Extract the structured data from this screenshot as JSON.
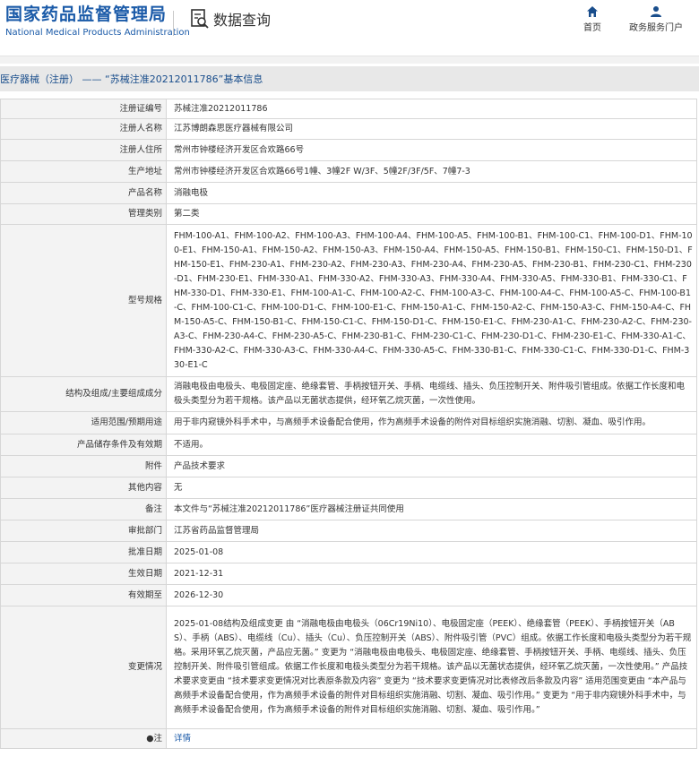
{
  "header": {
    "logo_cn": "国家药品监督管理局",
    "logo_en": "National Medical Products Administration",
    "section_title": "数据查询",
    "nav_home": "首页",
    "nav_service": "政务服务门户"
  },
  "breadcrumb": "医疗器械（注册） —— “苏械注准20212011786”基本信息",
  "rows": [
    {
      "label": "注册证编号",
      "value": "苏械注准20212011786"
    },
    {
      "label": "注册人名称",
      "value": "江苏博朗森思医疗器械有限公司"
    },
    {
      "label": "注册人住所",
      "value": "常州市钟楼经济开发区合欢路66号"
    },
    {
      "label": "生产地址",
      "value": "常州市钟楼经济开发区合欢路66号1幢、3幢2F W/3F、5幢2F/3F/5F、7幢7-3"
    },
    {
      "label": "产品名称",
      "value": "消融电极"
    },
    {
      "label": "管理类别",
      "value": "第二类"
    },
    {
      "label": "型号规格",
      "value": "FHM-100-A1、FHM-100-A2、FHM-100-A3、FHM-100-A4、FHM-100-A5、FHM-100-B1、FHM-100-C1、FHM-100-D1、FHM-100-E1、FHM-150-A1、FHM-150-A2、FHM-150-A3、FHM-150-A4、FHM-150-A5、FHM-150-B1、FHM-150-C1、FHM-150-D1、FHM-150-E1、FHM-230-A1、FHM-230-A2、FHM-230-A3、FHM-230-A4、FHM-230-A5、FHM-230-B1、FHM-230-C1、FHM-230-D1、FHM-230-E1、FHM-330-A1、FHM-330-A2、FHM-330-A3、FHM-330-A4、FHM-330-A5、FHM-330-B1、FHM-330-C1、FHM-330-D1、FHM-330-E1、FHM-100-A1-C、FHM-100-A2-C、FHM-100-A3-C、FHM-100-A4-C、FHM-100-A5-C、FHM-100-B1-C、FHM-100-C1-C、FHM-100-D1-C、FHM-100-E1-C、FHM-150-A1-C、FHM-150-A2-C、FHM-150-A3-C、FHM-150-A4-C、FHM-150-A5-C、FHM-150-B1-C、FHM-150-C1-C、FHM-150-D1-C、FHM-150-E1-C、FHM-230-A1-C、FHM-230-A2-C、FHM-230-A3-C、FHM-230-A4-C、FHM-230-A5-C、FHM-230-B1-C、FHM-230-C1-C、FHM-230-D1-C、FHM-230-E1-C、FHM-330-A1-C、FHM-330-A2-C、FHM-330-A3-C、FHM-330-A4-C、FHM-330-A5-C、FHM-330-B1-C、FHM-330-C1-C、FHM-330-D1-C、FHM-330-E1-C"
    },
    {
      "label": "结构及组成/主要组成成分",
      "value": "消融电极由电极头、电极固定座、绝缘套管、手柄按钮开关、手柄、电缆线、插头、负压控制开关、附件吸引管组成。依据工作长度和电极头类型分为若干规格。该产品以无菌状态提供，经环氧乙烷灭菌，一次性使用。"
    },
    {
      "label": "适用范围/预期用途",
      "value": "用于非内窥镜外科手术中，与高频手术设备配合使用，作为高频手术设备的附件对目标组织实施消融、切割、凝血、吸引作用。"
    },
    {
      "label": "产品储存条件及有效期",
      "value": "不适用。"
    },
    {
      "label": "附件",
      "value": "产品技术要求"
    },
    {
      "label": "其他内容",
      "value": "无"
    },
    {
      "label": "备注",
      "value": "本文件与“苏械注准20212011786”医疗器械注册证共同使用"
    },
    {
      "label": "审批部门",
      "value": "江苏省药品监督管理局"
    },
    {
      "label": "批准日期",
      "value": "2025-01-08"
    },
    {
      "label": "生效日期",
      "value": "2021-12-31"
    },
    {
      "label": "有效期至",
      "value": "2026-12-30"
    },
    {
      "label": "变更情况",
      "value": "2025-01-08结构及组成变更 由 “消融电极由电极头（06Cr19Ni10）、电极固定座（PEEK）、绝缘套管（PEEK）、手柄按钮开关（ABS）、手柄（ABS）、电缆线（Cu）、插头（Cu）、负压控制开关（ABS）、附件吸引管（PVC）组成。依据工作长度和电极头类型分为若干规格。采用环氧乙烷灭菌，产品应无菌。” 变更为 “消融电极由电极头、电极固定座、绝缘套管、手柄按钮开关、手柄、电缆线、插头、负压控制开关、附件吸引管组成。依据工作长度和电极头类型分为若干规格。该产品以无菌状态提供，经环氧乙烷灭菌，一次性使用。” 产品技术要求变更由 “技术要求变更情况对比表原条款及内容” 变更为 “技术要求变更情况对比表修改后条款及内容” 适用范围变更由 “本产品与高频手术设备配合使用，作为高频手术设备的附件对目标组织实施消融、切割、凝血、吸引作用。” 变更为 “用于非内窥镜外科手术中，与高频手术设备配合使用，作为高频手术设备的附件对目标组织实施消融、切割、凝血、吸引作用。”"
    }
  ],
  "note": {
    "label": "注",
    "value": "详情"
  }
}
